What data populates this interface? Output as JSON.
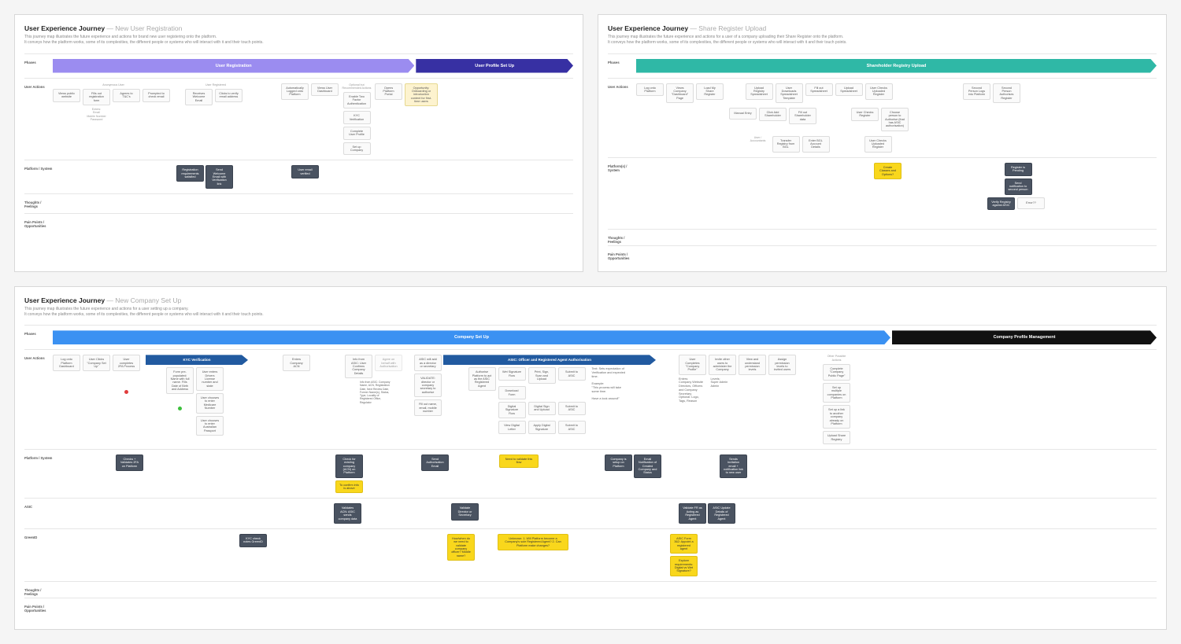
{
  "diagrams": {
    "a": {
      "title_strong": "User Experience Journey",
      "title_light": " — New User Registration",
      "desc": "This journey map illustrates the future experience and actions for brand new user registering onto the platform.\nIt conveys how the platform works, some of its complexities, the different people or systems who will interact with it and their touch points.",
      "lanes": {
        "phases": "Phases",
        "actions": "User Actions",
        "platform": "Platform / System",
        "thoughts": "Thoughts / Feelings",
        "pain": "Pain Points / Opportunities"
      },
      "phases": {
        "reg": "User Registration",
        "profile": "User Profile Set Up"
      },
      "actions": {
        "t_anon": "Anonymous User",
        "t_registered": "User Registered",
        "a0": "Views public website",
        "a1": "Fills out registration form",
        "a2": "Agrees to T&C's",
        "a3": "Prompted to check email",
        "a4": "Receives Welcome Email",
        "a5": "Clicks to verify email address",
        "a6": "Automatically Logged onto Platform",
        "a7": "Views User Dashboard",
        "a8": "Opens Platform Portal",
        "opt_hdr": "Optional but Recommended Actions",
        "o1": "Enable Two Factor Authentication",
        "o2": "KYC Verification",
        "o3": "Complete User Profile",
        "o4": "Set up Company",
        "n1": "Enters:\nEmail\nMobile Number\nPassword",
        "opp": "Opportunity:\nOnboarding or introduction content for first-time users"
      },
      "platform": {
        "p1": "Registration requirements satisfied",
        "p2": "Send Welcome Email with Verification link",
        "p3": "User email verified"
      }
    },
    "b": {
      "title_strong": "User Experience Journey",
      "title_light": " — Share Register Upload",
      "desc": "This journey map illustrates the future experience and actions for a user of a company uploading their Share Register onto the platform.\nIt conveys how the platform works, some of its complexities, the different people or systems who will interact with it and their touch points.",
      "lanes": {
        "phases": "Phases",
        "actions": "User Actions",
        "platform": "Platform(s) / System",
        "thoughts": "Thoughts / Feelings",
        "pain": "Pain Points / Opportunities"
      },
      "phases": {
        "upload": "Shareholder Registry Upload"
      },
      "actions": {
        "a0": "Log onto Platform",
        "a1": "Views Company \"Dashboard\" Page",
        "a2": "Load My Share Register",
        "a3": "Upload Registry Spreadsheet",
        "a4": "User Downloads Spreadsheet Template",
        "a5": "Fill out Spreadsheet",
        "a6": "Upload Spreadsheet",
        "a7": "User Checks Uploaded Register",
        "r2a": "Manual Entry",
        "r2b": "Click Add Shareholder",
        "r2c": "Fill out Shareholder data",
        "r2d": "User Checks Register",
        "r2e": "Choose person to Authorise (that has ASIC authorisation)",
        "r3a": "User / Accountants",
        "r3b": "Transfer Registry from BGL",
        "r3c": "Enter BGL Account Details",
        "r3d": "User Checks Uploaded Register",
        "sp1": "Second Person Logs into Platform",
        "sp2": "Second Person Authorises Register"
      },
      "platform": {
        "p1": "Create Classes and Options?",
        "p2": "Register is Pending",
        "p3": "Send notification to second person",
        "p4": "Verify Registry against ASIC",
        "p5": "Error??"
      }
    },
    "c": {
      "title_strong": "User Experience Journey",
      "title_light": " — New Company Set Up",
      "desc": "This journey map illustrates the future experience and actions for a user setting up a company.\nIt conveys how the platform works, some of its complexities, the different people or systems who will interact with it and their touch points.",
      "lanes": {
        "phases": "Phases",
        "actions": "User Actions",
        "platform": "Platform / System",
        "asic": "ASIC",
        "greenid": "GreenID",
        "thoughts": "Thoughts / Feelings",
        "pain": "Pain Points / Opportunities"
      },
      "phases": {
        "setup": "Company Set Up",
        "kyc": "KYC Verification",
        "asic": "ASIC: Officer and Registered Agent Authorisation",
        "mgmt": "Company Profile Management"
      },
      "actions": {
        "a0": "Log onto Platform Dashboard",
        "a1": "User Clicks \"Company Set Up\"",
        "a2": "User completes 2FA Process",
        "a3": "Form pre-populated: Name with full name. Fills Date of Birth and Address",
        "a4": "User enters Drivers License number and state",
        "a5": "User chooses to enter Medicare Number",
        "a6": "User chooses to enter Australian Passport",
        "a7": "Enters Company ACN",
        "a8": "Info from ASIC: User Confirms Company Details",
        "a8b": "Agree on behalf with Authorisation",
        "a8_note": "Info from ASIC: Company Name, ACN, Registration Date, Next Review Date, Former Name(s), Status, Type, Locality of Registered Office, Regulator",
        "a9": "ASIC will add as a director or secretary",
        "a10": "Authorise Platform to act as the ASIC Registered Agent",
        "m1": "Wet Signature Flow",
        "m1a": "Download Form",
        "m1b": "Print, Sign, Scan and Upload",
        "m1c": "Submit to ASIC",
        "m2": "Digital Signature Flow",
        "m2a": "Digital Sign and Upload",
        "m2b": "Submit to ASIC",
        "m3": "View Digital Letter",
        "m3a": "Apply Digital Signature",
        "m3b": "Submit to ASIC",
        "side": "Text: Sets expectation of Verification and expected time.\n\nExample:\n\"This process will take some time.\n\nHave a look around!\"",
        "v1": "VALIDATE: director or company secretary to authorise",
        "v2": "Fill out name, email, mobile number",
        "u1": "User Completes \"Company Profile\"",
        "u2": "Invite other users to administer the Company",
        "u3": "View and understand permission levels",
        "u4": "Assign permission levels to invited users",
        "u1n": "Enters:\nCompany Website\nDirectors, Officers and Company Secretary\nOptional: Logo, Tags, Reason",
        "u2n": "Levels:\nSuper Admin\nAdmin",
        "extra_hdr": "Other Possible Actions",
        "e1": "Complete \"Company Public Page\"",
        "e2": "Set up multiple companies on Platform",
        "e3": "Set up a link to another company already on Platform",
        "e4": "Upload Share Registry"
      },
      "platform": {
        "p1": "Checks + Validates 2FA on Platform",
        "p2": "Check for existing company (ACN) on Platform",
        "p3": "To confirm info is above",
        "p4": "Send Authorisation Email",
        "p5": "Need to validate this flow",
        "p6": "Company is setup on Platform",
        "p7": "Email Notification of Created Company and Status",
        "p8": "Sends invitation email + notification link to new user"
      },
      "asic": {
        "a1": "Validates ACN: ASIC sends company data",
        "a2": "Validate Director or Secretary",
        "a3": "Validate FR as Acting as Registered Agent",
        "a4": "ASIC Update Details of Registered Agent"
      },
      "greenid": {
        "g1": "KYC check notes GreenID",
        "g2": "How/when do we need to validate company officer? Middle name?",
        "g3": "Unknown:\n1. Will Platform become a Company's sole Registered Agent?\n2. Can Platform make changes?",
        "g4": "ASIC Form 362: Appoint a registered agent",
        "g5": "Explore requirements: Digital vs Wet Signature?"
      }
    }
  }
}
